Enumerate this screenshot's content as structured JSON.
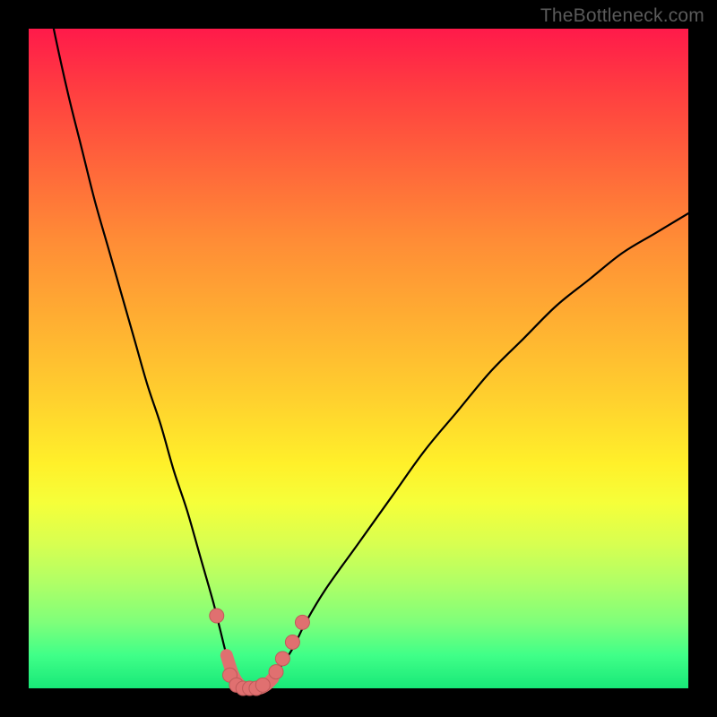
{
  "watermark": "TheBottleneck.com",
  "colors": {
    "frame": "#000000",
    "gradient_top": "#ff1a4a",
    "gradient_mid": "#ffd02e",
    "gradient_bottom": "#18e878",
    "curve": "#000000",
    "marker_fill": "#e07070",
    "marker_stroke": "#c05a5a"
  },
  "chart_data": {
    "type": "line",
    "title": "",
    "xlabel": "",
    "ylabel": "",
    "xlim": [
      0,
      100
    ],
    "ylim": [
      0,
      100
    ],
    "series": [
      {
        "name": "bottleneck-curve",
        "x": [
          0,
          2,
          4,
          6,
          8,
          10,
          12,
          14,
          16,
          18,
          20,
          22,
          24,
          26,
          28,
          29,
          30,
          31,
          32,
          33,
          34,
          35,
          36,
          37,
          38,
          40,
          42,
          45,
          50,
          55,
          60,
          65,
          70,
          75,
          80,
          85,
          90,
          95,
          100
        ],
        "y": [
          120,
          109,
          99,
          90,
          82,
          74,
          67,
          60,
          53,
          46,
          40,
          33,
          27,
          20,
          13,
          9,
          5,
          2,
          0.5,
          0,
          0,
          0,
          0.5,
          1.5,
          3,
          6,
          10,
          15,
          22,
          29,
          36,
          42,
          48,
          53,
          58,
          62,
          66,
          69,
          72
        ]
      }
    ],
    "markers": [
      {
        "x": 28.5,
        "y": 11
      },
      {
        "x": 30.5,
        "y": 2
      },
      {
        "x": 31.5,
        "y": 0.5
      },
      {
        "x": 32.5,
        "y": 0
      },
      {
        "x": 33.5,
        "y": 0
      },
      {
        "x": 34.5,
        "y": 0
      },
      {
        "x": 35.5,
        "y": 0.5
      },
      {
        "x": 37.5,
        "y": 2.5
      },
      {
        "x": 38.5,
        "y": 4.5
      },
      {
        "x": 40,
        "y": 7
      },
      {
        "x": 41.5,
        "y": 10
      }
    ]
  }
}
